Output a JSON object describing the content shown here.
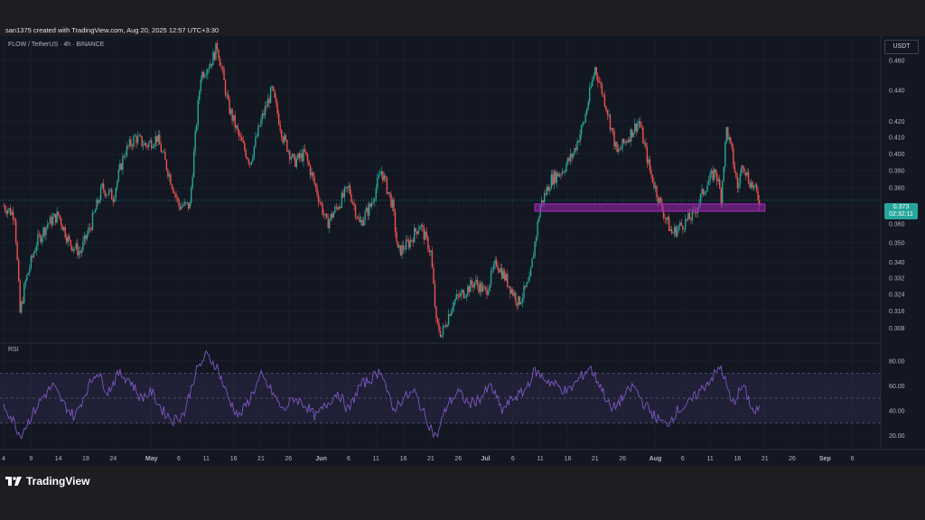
{
  "header": {
    "caption": "san1375 created with TradingView.com, Aug 20, 2025 12:57 UTC+3:30"
  },
  "legend": {
    "symbol": "FLOW / TetherUS · 4h · BINANCE"
  },
  "currency": "USDT",
  "last_price": {
    "value": "0.373",
    "countdown": "02:32:11"
  },
  "brand": {
    "name": "TradingView",
    "icon": "tradingview-logo-icon"
  },
  "colors": {
    "up": "#26a69a",
    "down": "#ef5350",
    "zone": "#9c27b0",
    "rsi_line": "#7e57c2",
    "rsi_band": "#7e57c2",
    "background": "#131722",
    "grid": "#1f2330"
  },
  "chart_data": [
    {
      "type": "candlestick",
      "title": "",
      "xlabel": "",
      "ylabel": "",
      "x_ticks": [
        "4",
        "9",
        "14",
        "19",
        "24",
        "May",
        "6",
        "11",
        "16",
        "21",
        "26",
        "Jun",
        "6",
        "11",
        "16",
        "21",
        "26",
        "Jul",
        "6",
        "11",
        "16",
        "21",
        "26",
        "Aug",
        "6",
        "11",
        "16",
        "21",
        "26",
        "Sep",
        "6"
      ],
      "y_ticks": [
        0.308,
        0.316,
        0.324,
        0.332,
        0.34,
        0.35,
        0.36,
        0.37,
        0.38,
        0.39,
        0.4,
        0.41,
        0.42,
        0.44,
        0.46
      ],
      "y_scale": "log",
      "ylim": [
        0.302,
        0.472
      ],
      "grid": true,
      "x_range": [
        "2025-04-04",
        "2025-09-10"
      ],
      "series": [
        {
          "data_approx": [
            {
              "date": "2025-04-04",
              "close": 0.37
            },
            {
              "date": "2025-04-06",
              "close": 0.365
            },
            {
              "date": "2025-04-07",
              "close": 0.315
            },
            {
              "date": "2025-04-08",
              "close": 0.33
            },
            {
              "date": "2025-04-10",
              "close": 0.35
            },
            {
              "date": "2025-04-12",
              "close": 0.36
            },
            {
              "date": "2025-04-14",
              "close": 0.365
            },
            {
              "date": "2025-04-16",
              "close": 0.35
            },
            {
              "date": "2025-04-18",
              "close": 0.345
            },
            {
              "date": "2025-04-20",
              "close": 0.36
            },
            {
              "date": "2025-04-22",
              "close": 0.38
            },
            {
              "date": "2025-04-24",
              "close": 0.375
            },
            {
              "date": "2025-04-26",
              "close": 0.4
            },
            {
              "date": "2025-04-28",
              "close": 0.41
            },
            {
              "date": "2025-04-30",
              "close": 0.405
            },
            {
              "date": "2025-05-02",
              "close": 0.41
            },
            {
              "date": "2025-05-04",
              "close": 0.39
            },
            {
              "date": "2025-05-06",
              "close": 0.37
            },
            {
              "date": "2025-05-08",
              "close": 0.37
            },
            {
              "date": "2025-05-09",
              "close": 0.41
            },
            {
              "date": "2025-05-10",
              "close": 0.45
            },
            {
              "date": "2025-05-12",
              "close": 0.46
            },
            {
              "date": "2025-05-13",
              "close": 0.47
            },
            {
              "date": "2025-05-15",
              "close": 0.43
            },
            {
              "date": "2025-05-17",
              "close": 0.41
            },
            {
              "date": "2025-05-19",
              "close": 0.395
            },
            {
              "date": "2025-05-21",
              "close": 0.42
            },
            {
              "date": "2025-05-23",
              "close": 0.44
            },
            {
              "date": "2025-05-25",
              "close": 0.41
            },
            {
              "date": "2025-05-27",
              "close": 0.395
            },
            {
              "date": "2025-05-29",
              "close": 0.4
            },
            {
              "date": "2025-05-31",
              "close": 0.38
            },
            {
              "date": "2025-06-02",
              "close": 0.36
            },
            {
              "date": "2025-06-04",
              "close": 0.37
            },
            {
              "date": "2025-06-06",
              "close": 0.38
            },
            {
              "date": "2025-06-08",
              "close": 0.36
            },
            {
              "date": "2025-06-10",
              "close": 0.37
            },
            {
              "date": "2025-06-12",
              "close": 0.39
            },
            {
              "date": "2025-06-14",
              "close": 0.37
            },
            {
              "date": "2025-06-15",
              "close": 0.345
            },
            {
              "date": "2025-06-17",
              "close": 0.35
            },
            {
              "date": "2025-06-19",
              "close": 0.36
            },
            {
              "date": "2025-06-21",
              "close": 0.345
            },
            {
              "date": "2025-06-22",
              "close": 0.31
            },
            {
              "date": "2025-06-23",
              "close": 0.305
            },
            {
              "date": "2025-06-25",
              "close": 0.32
            },
            {
              "date": "2025-06-27",
              "close": 0.325
            },
            {
              "date": "2025-06-29",
              "close": 0.33
            },
            {
              "date": "2025-07-01",
              "close": 0.325
            },
            {
              "date": "2025-07-03",
              "close": 0.34
            },
            {
              "date": "2025-07-05",
              "close": 0.33
            },
            {
              "date": "2025-07-07",
              "close": 0.32
            },
            {
              "date": "2025-07-09",
              "close": 0.33
            },
            {
              "date": "2025-07-11",
              "close": 0.37
            },
            {
              "date": "2025-07-13",
              "close": 0.385
            },
            {
              "date": "2025-07-15",
              "close": 0.39
            },
            {
              "date": "2025-07-17",
              "close": 0.4
            },
            {
              "date": "2025-07-19",
              "close": 0.42
            },
            {
              "date": "2025-07-21",
              "close": 0.455
            },
            {
              "date": "2025-07-23",
              "close": 0.43
            },
            {
              "date": "2025-07-25",
              "close": 0.4
            },
            {
              "date": "2025-07-27",
              "close": 0.41
            },
            {
              "date": "2025-07-29",
              "close": 0.42
            },
            {
              "date": "2025-07-31",
              "close": 0.39
            },
            {
              "date": "2025-08-02",
              "close": 0.37
            },
            {
              "date": "2025-08-04",
              "close": 0.355
            },
            {
              "date": "2025-08-06",
              "close": 0.36
            },
            {
              "date": "2025-08-08",
              "close": 0.365
            },
            {
              "date": "2025-08-10",
              "close": 0.38
            },
            {
              "date": "2025-08-12",
              "close": 0.39
            },
            {
              "date": "2025-08-13",
              "close": 0.375
            },
            {
              "date": "2025-08-14",
              "close": 0.415
            },
            {
              "date": "2025-08-15",
              "close": 0.4
            },
            {
              "date": "2025-08-16",
              "close": 0.38
            },
            {
              "date": "2025-08-17",
              "close": 0.395
            },
            {
              "date": "2025-08-18",
              "close": 0.385
            },
            {
              "date": "2025-08-19",
              "close": 0.38
            },
            {
              "date": "2025-08-20",
              "close": 0.373
            }
          ]
        }
      ],
      "annotations": [
        {
          "type": "zone",
          "from": "2025-07-10",
          "to": "2025-08-21",
          "y_low": 0.367,
          "y_high": 0.371
        }
      ]
    },
    {
      "type": "line",
      "title": "RSI",
      "xlabel": "",
      "ylabel": "",
      "y_ticks": [
        20,
        40,
        60,
        80
      ],
      "ylim": [
        10,
        90
      ],
      "band": [
        30,
        70
      ],
      "midline": 50,
      "grid": true,
      "series": [
        {
          "data_approx": [
            {
              "date": "2025-04-04",
              "value": 45
            },
            {
              "date": "2025-04-06",
              "value": 30
            },
            {
              "date": "2025-04-07",
              "value": 20
            },
            {
              "date": "2025-04-09",
              "value": 35
            },
            {
              "date": "2025-04-11",
              "value": 50
            },
            {
              "date": "2025-04-13",
              "value": 60
            },
            {
              "date": "2025-04-15",
              "value": 45
            },
            {
              "date": "2025-04-17",
              "value": 35
            },
            {
              "date": "2025-04-19",
              "value": 55
            },
            {
              "date": "2025-04-21",
              "value": 72
            },
            {
              "date": "2025-04-23",
              "value": 55
            },
            {
              "date": "2025-04-25",
              "value": 70
            },
            {
              "date": "2025-04-27",
              "value": 65
            },
            {
              "date": "2025-04-29",
              "value": 50
            },
            {
              "date": "2025-05-01",
              "value": 55
            },
            {
              "date": "2025-05-03",
              "value": 40
            },
            {
              "date": "2025-05-05",
              "value": 32
            },
            {
              "date": "2025-05-07",
              "value": 38
            },
            {
              "date": "2025-05-09",
              "value": 70
            },
            {
              "date": "2025-05-11",
              "value": 85
            },
            {
              "date": "2025-05-13",
              "value": 75
            },
            {
              "date": "2025-05-15",
              "value": 50
            },
            {
              "date": "2025-05-17",
              "value": 35
            },
            {
              "date": "2025-05-19",
              "value": 50
            },
            {
              "date": "2025-05-21",
              "value": 68
            },
            {
              "date": "2025-05-23",
              "value": 55
            },
            {
              "date": "2025-05-25",
              "value": 40
            },
            {
              "date": "2025-05-27",
              "value": 50
            },
            {
              "date": "2025-05-29",
              "value": 45
            },
            {
              "date": "2025-05-31",
              "value": 35
            },
            {
              "date": "2025-06-02",
              "value": 45
            },
            {
              "date": "2025-06-04",
              "value": 55
            },
            {
              "date": "2025-06-06",
              "value": 40
            },
            {
              "date": "2025-06-08",
              "value": 60
            },
            {
              "date": "2025-06-10",
              "value": 65
            },
            {
              "date": "2025-06-12",
              "value": 73
            },
            {
              "date": "2025-06-14",
              "value": 40
            },
            {
              "date": "2025-06-16",
              "value": 50
            },
            {
              "date": "2025-06-18",
              "value": 55
            },
            {
              "date": "2025-06-20",
              "value": 35
            },
            {
              "date": "2025-06-22",
              "value": 18
            },
            {
              "date": "2025-06-24",
              "value": 45
            },
            {
              "date": "2025-06-26",
              "value": 55
            },
            {
              "date": "2025-06-28",
              "value": 45
            },
            {
              "date": "2025-06-30",
              "value": 50
            },
            {
              "date": "2025-07-02",
              "value": 60
            },
            {
              "date": "2025-07-04",
              "value": 40
            },
            {
              "date": "2025-07-06",
              "value": 50
            },
            {
              "date": "2025-07-08",
              "value": 55
            },
            {
              "date": "2025-07-10",
              "value": 72
            },
            {
              "date": "2025-07-12",
              "value": 65
            },
            {
              "date": "2025-07-14",
              "value": 60
            },
            {
              "date": "2025-07-16",
              "value": 55
            },
            {
              "date": "2025-07-18",
              "value": 65
            },
            {
              "date": "2025-07-20",
              "value": 75
            },
            {
              "date": "2025-07-22",
              "value": 60
            },
            {
              "date": "2025-07-24",
              "value": 40
            },
            {
              "date": "2025-07-26",
              "value": 50
            },
            {
              "date": "2025-07-28",
              "value": 60
            },
            {
              "date": "2025-07-30",
              "value": 45
            },
            {
              "date": "2025-08-01",
              "value": 35
            },
            {
              "date": "2025-08-03",
              "value": 28
            },
            {
              "date": "2025-08-05",
              "value": 40
            },
            {
              "date": "2025-08-07",
              "value": 45
            },
            {
              "date": "2025-08-09",
              "value": 55
            },
            {
              "date": "2025-08-11",
              "value": 65
            },
            {
              "date": "2025-08-13",
              "value": 75
            },
            {
              "date": "2025-08-15",
              "value": 45
            },
            {
              "date": "2025-08-17",
              "value": 60
            },
            {
              "date": "2025-08-19",
              "value": 38
            },
            {
              "date": "2025-08-20",
              "value": 42
            }
          ]
        }
      ]
    }
  ]
}
